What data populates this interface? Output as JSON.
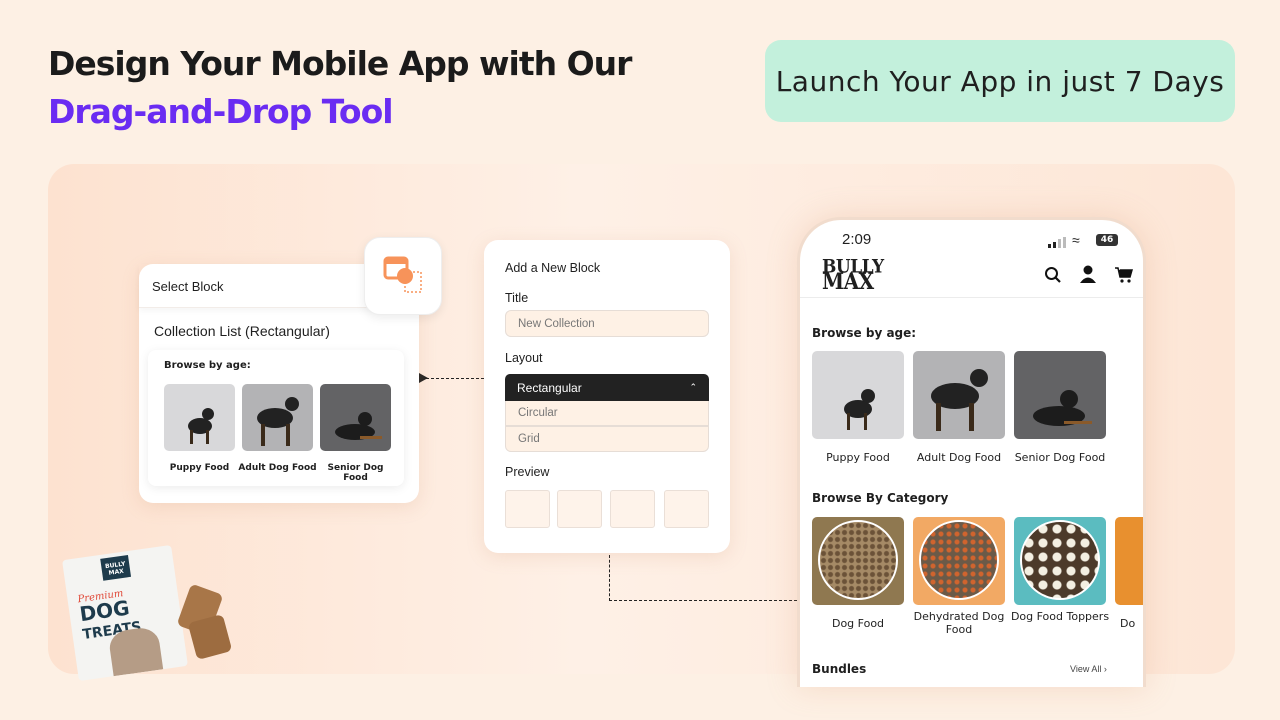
{
  "headline": {
    "line1": "Design Your Mobile App with Our",
    "line2": "Drag-and-Drop Tool"
  },
  "badge": "Launch Your App in just 7 Days",
  "select_block": {
    "header": "Select Block",
    "subtitle": "Collection List (Rectangular)",
    "section": "Browse by age:",
    "items": [
      "Puppy Food",
      "Adult Dog Food",
      "Senior Dog Food"
    ]
  },
  "add_block": {
    "title": "Add a New Block",
    "title_label": "Title",
    "title_placeholder": "New Collection",
    "layout_label": "Layout",
    "layout_selected": "Rectangular",
    "layout_options": [
      "Circular",
      "Grid"
    ],
    "preview_label": "Preview"
  },
  "phone": {
    "time": "2:09",
    "battery": "46",
    "logo": "BULLY MAX",
    "browse_age": "Browse by age:",
    "age_items": [
      "Puppy Food",
      "Adult Dog Food",
      "Senior Dog Food"
    ],
    "browse_category": "Browse By Category",
    "category_items": [
      "Dog Food",
      "Dehydrated Dog Food",
      "Dog Food Toppers",
      "Do"
    ],
    "bundles": "Bundles",
    "view_all": "View All"
  },
  "product": {
    "brand": "BULLY MAX",
    "name": "Premium DOG TREATS"
  },
  "colors": {
    "accent": "#6a2cf2",
    "badge": "#c3f0dc",
    "icon": "#f7935a"
  }
}
